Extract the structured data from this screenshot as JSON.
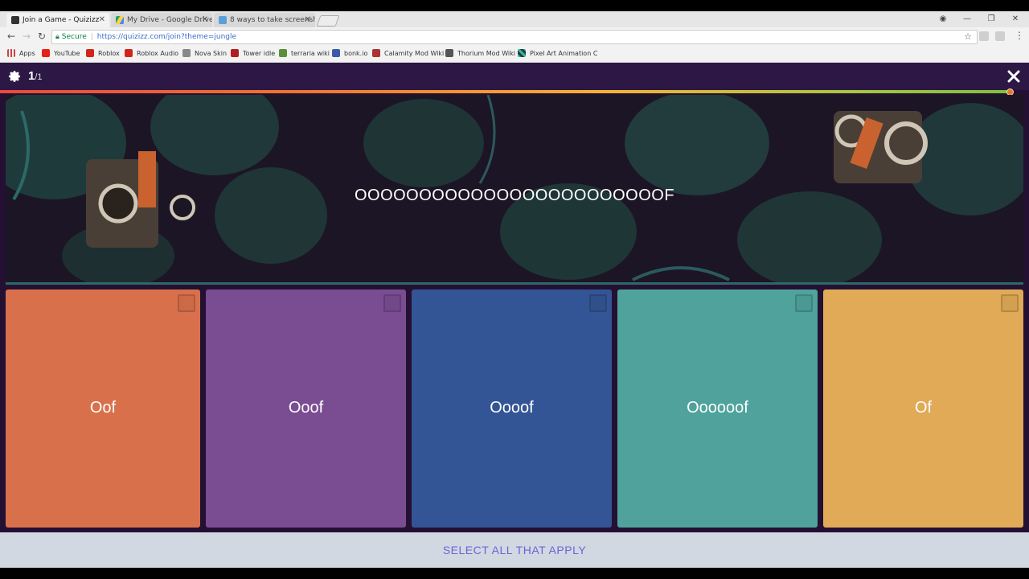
{
  "browser": {
    "tabs": [
      {
        "title": "Join a Game - Quizizz",
        "active": true
      },
      {
        "title": "My Drive - Google Drive",
        "active": false
      },
      {
        "title": "8 ways to take screensho",
        "active": false
      }
    ],
    "secure_label": "Secure",
    "url": "https://quizizz.com/join?theme=jungle",
    "bookmarks": [
      "Apps",
      "YouTube",
      "Roblox",
      "Roblox Audio",
      "Nova Skin",
      "Tower idle",
      "terraria wiki",
      "bonk.io",
      "Calamity Mod Wiki",
      "Thorium Mod Wiki",
      "Pixel Art Animation C"
    ]
  },
  "game": {
    "counter_current": "1",
    "counter_total": "/1",
    "timer_remaining_fraction": 0.99,
    "question": "OOOOOOOOOOOOOOOOOOOOOOOOF",
    "options": [
      {
        "label": "Oof",
        "color": "#d9704c"
      },
      {
        "label": "Ooof",
        "color": "#7a4d93"
      },
      {
        "label": "Oooof",
        "color": "#345595"
      },
      {
        "label": "Oooooof",
        "color": "#4fa39c"
      },
      {
        "label": "Of",
        "color": "#e0aa57"
      }
    ],
    "footer_text": "SELECT ALL THAT APPLY"
  }
}
